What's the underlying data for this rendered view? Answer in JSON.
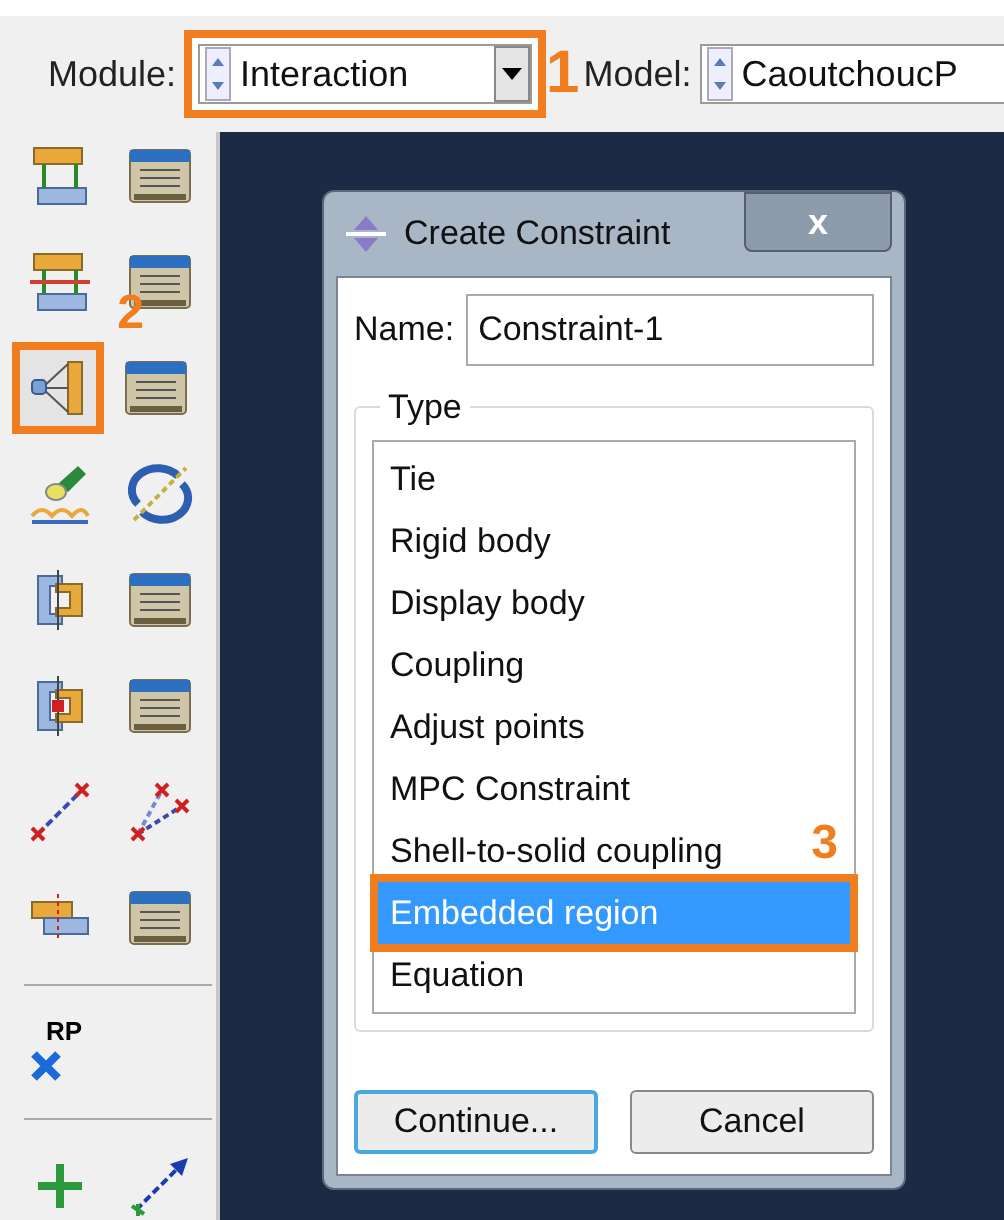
{
  "toolbar": {
    "fields": [
      {
        "label": "Module:",
        "value": "Interaction",
        "highlighted": true,
        "marker": "1"
      },
      {
        "label": "Model:",
        "value": "CaoutchoucP",
        "highlighted": false
      }
    ]
  },
  "tools": [
    {
      "kind": "tie",
      "highlighted": false
    },
    {
      "kind": "manager",
      "highlighted": false
    },
    {
      "kind": "tie-cut",
      "highlighted": false
    },
    {
      "kind": "manager",
      "highlighted": false
    },
    {
      "kind": "coupling",
      "highlighted": true,
      "marker": "2"
    },
    {
      "kind": "manager",
      "highlighted": false
    },
    {
      "kind": "flashlight",
      "highlighted": false
    },
    {
      "kind": "rotate",
      "highlighted": false
    },
    {
      "kind": "bracket",
      "highlighted": false
    },
    {
      "kind": "manager",
      "highlighted": false
    },
    {
      "kind": "bracket-dot",
      "highlighted": false
    },
    {
      "kind": "manager",
      "highlighted": false
    },
    {
      "kind": "line",
      "highlighted": false
    },
    {
      "kind": "lines",
      "highlighted": false
    },
    {
      "kind": "plates",
      "highlighted": false
    },
    {
      "kind": "manager",
      "highlighted": false
    },
    {
      "kind": "separator"
    },
    {
      "kind": "rp",
      "label": "RP",
      "highlighted": false
    },
    {
      "kind": "separator"
    },
    {
      "kind": "plus",
      "highlighted": false
    },
    {
      "kind": "arrow",
      "highlighted": false
    }
  ],
  "dialog": {
    "title": "Create Constraint",
    "close": "x",
    "name_label": "Name:",
    "name_value": "Constraint-1",
    "group_label": "Type",
    "types": [
      {
        "label": "Tie",
        "selected": false,
        "highlighted": false
      },
      {
        "label": "Rigid body",
        "selected": false,
        "highlighted": false
      },
      {
        "label": "Display body",
        "selected": false,
        "highlighted": false
      },
      {
        "label": "Coupling",
        "selected": false,
        "highlighted": false
      },
      {
        "label": "Adjust points",
        "selected": false,
        "highlighted": false
      },
      {
        "label": "MPC Constraint",
        "selected": false,
        "highlighted": false
      },
      {
        "label": "Shell-to-solid coupling",
        "selected": false,
        "highlighted": false,
        "marker": "3"
      },
      {
        "label": "Embedded region",
        "selected": true,
        "highlighted": true
      },
      {
        "label": "Equation",
        "selected": false,
        "highlighted": false
      }
    ],
    "buttons": [
      {
        "label": "Continue...",
        "kind": "default"
      },
      {
        "label": "Cancel",
        "kind": "normal"
      }
    ]
  }
}
